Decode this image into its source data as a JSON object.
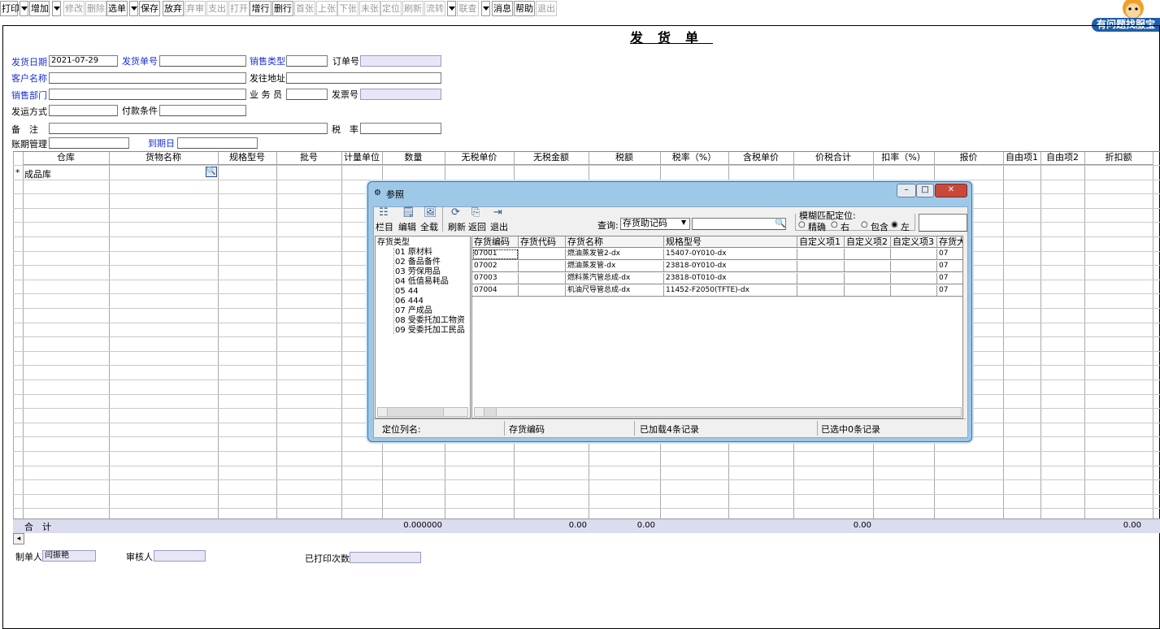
{
  "toolbar": {
    "buttons": [
      {
        "label": "打印",
        "disabled": false
      },
      {
        "label": "增加",
        "disabled": false
      },
      {
        "label": "修改",
        "disabled": true
      },
      {
        "label": "删除",
        "disabled": true
      },
      {
        "label": "选单",
        "disabled": false
      },
      {
        "label": "保存",
        "disabled": false
      },
      {
        "label": "放弃",
        "disabled": false
      },
      {
        "label": "弃审",
        "disabled": true
      },
      {
        "label": "支出",
        "disabled": true
      },
      {
        "label": "打开",
        "disabled": true
      },
      {
        "label": "增行",
        "disabled": false
      },
      {
        "label": "删行",
        "disabled": false
      },
      {
        "label": "首张",
        "disabled": true
      },
      {
        "label": "上张",
        "disabled": true
      },
      {
        "label": "下张",
        "disabled": true
      },
      {
        "label": "末张",
        "disabled": true
      },
      {
        "label": "定位",
        "disabled": true
      },
      {
        "label": "刷新",
        "disabled": true
      },
      {
        "label": "流转",
        "disabled": true
      },
      {
        "label": "联查",
        "disabled": true
      },
      {
        "label": "消息",
        "disabled": false
      },
      {
        "label": "帮助",
        "disabled": false
      },
      {
        "label": "退出",
        "disabled": true
      }
    ],
    "help_service": "有问题找服宝"
  },
  "form": {
    "title": "发货单",
    "fields": {
      "ship_date_label": "发货日期",
      "ship_date_value": "2021-07-29",
      "ship_no_label": "发货单号",
      "ship_no_value": "",
      "sales_type_label": "销售类型",
      "sales_type_value": "",
      "order_no_label": "订单号",
      "order_no_value": "",
      "customer_label": "客户名称",
      "customer_value": "",
      "ship_addr_label": "发往地址",
      "ship_addr_value": "",
      "sales_dept_label": "销售部门",
      "sales_dept_value": "",
      "salesman_label": "业 务 员",
      "salesman_value": "",
      "invoice_no_label": "发票号",
      "invoice_no_value": "",
      "ship_method_label": "发运方式",
      "ship_method_value": "",
      "pay_terms_label": "付款条件",
      "pay_terms_value": "",
      "remark_label": "备　注",
      "remark_value": "",
      "tax_rate_label": "税　率",
      "tax_rate_value": "",
      "period_label": "账期管理",
      "period_value": "",
      "due_date_label": "到期日",
      "due_date_value": ""
    }
  },
  "grid": {
    "columns": [
      "仓库",
      "货物名称",
      "规格型号",
      "批号",
      "计量单位",
      "数量",
      "无税单价",
      "无税金额",
      "税额",
      "税率（%）",
      "含税单价",
      "价税合计",
      "扣率（%）",
      "报价",
      "自由项1",
      "自由项2",
      "折扣额"
    ],
    "rows": [
      {
        "marker": "*",
        "warehouse": "成品库"
      }
    ],
    "sum": {
      "label": "合　计",
      "quantity": "0.000000",
      "net_amount": "0.00",
      "tax": "0.00",
      "total": "0.00",
      "discount": "0.00"
    }
  },
  "footer": {
    "maker_label": "制单人",
    "maker_value": "闫振艳",
    "auditor_label": "审核人",
    "auditor_value": "",
    "print_count_label": "已打印次数",
    "print_count_value": ""
  },
  "dialog": {
    "title": "参照",
    "tools": [
      "栏目",
      "编辑",
      "全载",
      "刷新",
      "返回",
      "退出"
    ],
    "query_label": "查询:",
    "query_field": "存货助记码",
    "search_value": "",
    "fuzzy_label": "模糊匹配定位:",
    "fuzzy_options": [
      "精确",
      "右",
      "包含",
      "左"
    ],
    "fuzzy_selected": "左",
    "tree_root": "存货类型",
    "tree_items": [
      "01 原材料",
      "02 备品备件",
      "03 劳保用品",
      "04 低值易耗品",
      "05 44",
      "06 444",
      "07 产成品",
      "08 受委托加工物资",
      "09 受委托加工民品"
    ],
    "list_columns": [
      "存货编码",
      "存货代码",
      "存货名称",
      "规格型号",
      "自定义项1",
      "自定义项2",
      "自定义项3",
      "存货大类"
    ],
    "list_rows": [
      [
        "07001",
        "",
        "燃油蒸发管2-dx",
        "15407-0Y010-dx",
        "",
        "",
        "",
        "07"
      ],
      [
        "07002",
        "",
        "燃油蒸发管-dx",
        "23818-0Y010-dx",
        "",
        "",
        "",
        "07"
      ],
      [
        "07003",
        "",
        "燃料蒸汽管总成-dx",
        "23818-0T010-dx",
        "",
        "",
        "",
        "07"
      ],
      [
        "07004",
        "",
        "机油尺导管总成-dx",
        "11452-F2050(TFTE)-dx",
        "",
        "",
        "",
        "07"
      ]
    ],
    "status": {
      "locate_label": "定位列名:",
      "locate_value": "存货编码",
      "loaded": "已加载4条记录",
      "selected": "已选中0条记录"
    }
  }
}
